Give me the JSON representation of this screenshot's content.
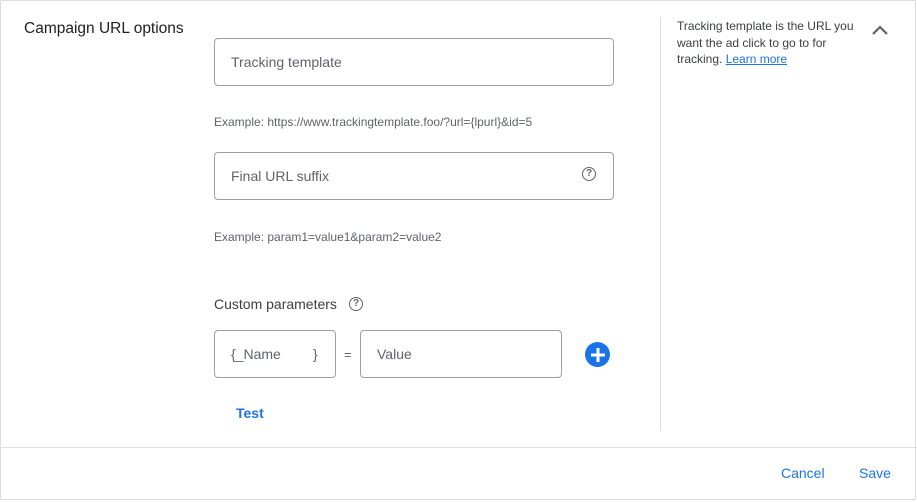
{
  "section": {
    "title": "Campaign URL options"
  },
  "tracking_template": {
    "placeholder": "Tracking template",
    "example": "Example: https://www.trackingtemplate.foo/?url={lpurl}&id=5"
  },
  "final_url_suffix": {
    "placeholder": "Final URL suffix",
    "example": "Example: param1=value1&param2=value2"
  },
  "custom_parameters": {
    "label": "Custom parameters",
    "name_placeholder": "{_Name",
    "name_close_brace": "}",
    "equals": "=",
    "value_placeholder": "Value"
  },
  "test_label": "Test",
  "help_panel": {
    "text": "Tracking template is the URL you want the ad click to go to for tracking.",
    "link": "Learn more"
  },
  "footer": {
    "cancel_label": "Cancel",
    "save_label": "Save"
  },
  "colors": {
    "accent": "#1a73e8",
    "border": "#9aa0a6",
    "divider": "#dadce0"
  },
  "icons": {
    "collapse": "chevron-up-icon",
    "help": "help-circle-icon",
    "add": "add-circle-icon"
  }
}
